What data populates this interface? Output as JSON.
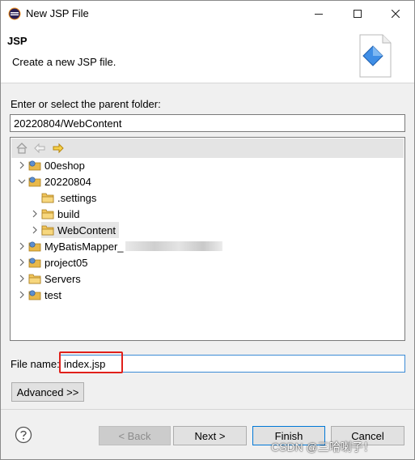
{
  "window": {
    "title": "New JSP File",
    "controls": {
      "minimize": "—",
      "maximize": "☐",
      "close": "✕"
    },
    "icon": "eclipse-icon"
  },
  "banner": {
    "title": "JSP",
    "description": "Create a new JSP file.",
    "art_icon": "jsp-wizard-icon"
  },
  "parent_folder": {
    "label": "Enter or select the parent folder:",
    "value": "20220804/WebContent"
  },
  "tree": {
    "toolbar": [
      "home-icon",
      "back-arrow-icon",
      "forward-arrow-icon"
    ],
    "items": [
      {
        "label": "00eshop",
        "icon": "project-icon",
        "expanded": false
      },
      {
        "label": "20220804",
        "icon": "project-icon",
        "expanded": true
      },
      {
        "label": ".settings",
        "icon": "folder-icon",
        "expanded": null
      },
      {
        "label": "build",
        "icon": "folder-icon",
        "expanded": false
      },
      {
        "label": "WebContent",
        "icon": "folder-icon",
        "expanded": false,
        "selected": true
      },
      {
        "label": "MyBatisMapper_",
        "icon": "project-icon",
        "expanded": false
      },
      {
        "label": "project05",
        "icon": "project-icon",
        "expanded": false
      },
      {
        "label": "Servers",
        "icon": "folder-icon",
        "expanded": false
      },
      {
        "label": "test",
        "icon": "project-icon",
        "expanded": false
      }
    ]
  },
  "file_name": {
    "label": "File name:",
    "value": "index.jsp"
  },
  "buttons": {
    "advanced": "Advanced >>",
    "back": "< Back",
    "next": "Next >",
    "finish": "Finish",
    "cancel": "Cancel"
  },
  "watermark": "CSDN @三哈喇子！",
  "colors": {
    "accent": "#0078d7",
    "highlight": "#e0201a",
    "folder": "#e8b84a"
  }
}
